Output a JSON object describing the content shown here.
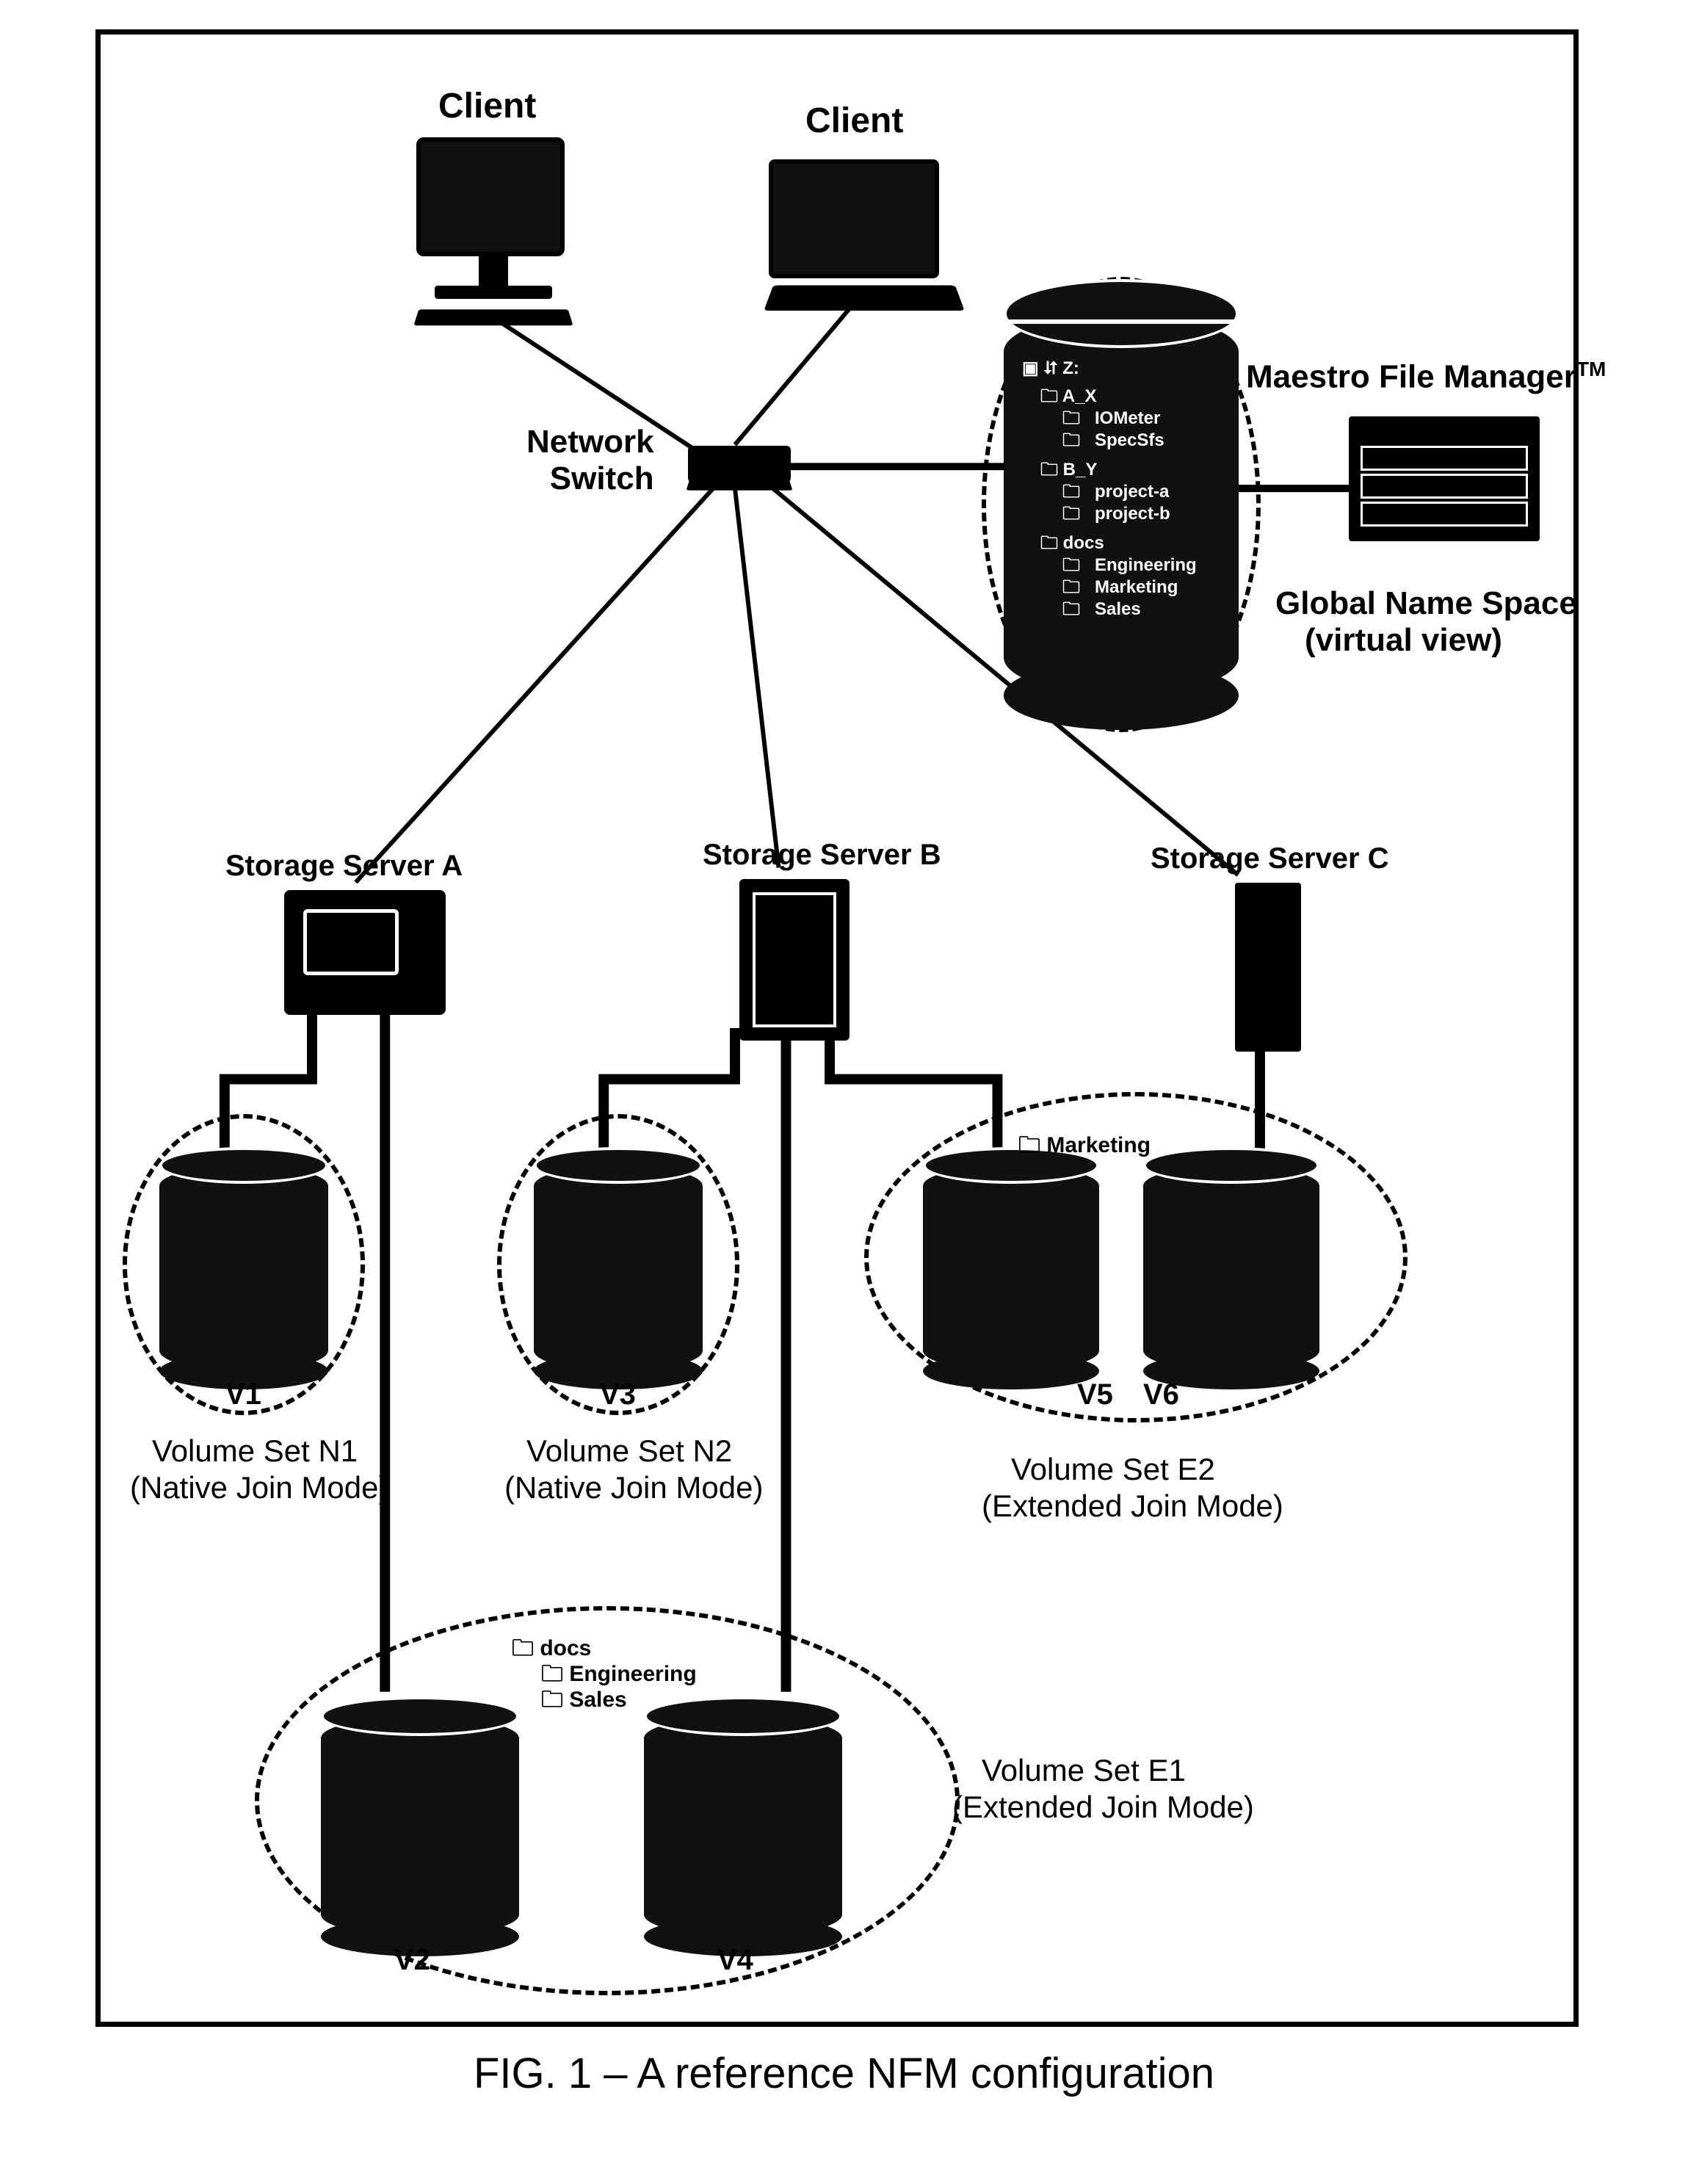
{
  "caption": "FIG. 1 – A reference NFM configuration",
  "labels": {
    "client1": "Client",
    "client2": "Client",
    "network_switch": "Network\nSwitch",
    "mfm": "Maestro File Manager",
    "mfm_tm": "TM",
    "gns_line1": "Global Name Space",
    "gns_line2": "(virtual view)",
    "serverA": "Storage Server A",
    "serverB": "Storage Server B",
    "serverC": "Storage Server C",
    "v1": "V1",
    "v2": "V2",
    "v3": "V3",
    "v4": "V4",
    "v5": "V5",
    "v6": "V6",
    "vs_n1_line1": "Volume Set N1",
    "vs_n1_line2": "(Native Join Mode)",
    "vs_n2_line1": "Volume Set N2",
    "vs_n2_line2": "(Native Join Mode)",
    "vs_e1_line1": "Volume Set E1",
    "vs_e1_line2": "(Extended Join Mode)",
    "vs_e2_line1": "Volume Set E2",
    "vs_e2_line2": "(Extended Join Mode)"
  },
  "gns_tree": {
    "root": "Z:",
    "items": [
      "A_X",
      "  IOMeter",
      "  SpecSfs",
      "B_Y",
      "  project-a",
      "  project-b",
      "docs",
      "  Engineering",
      "  Marketing",
      "  Sales"
    ]
  },
  "e1_folders": [
    "docs",
    "Engineering",
    "Sales"
  ],
  "e2_folders": [
    "Marketing"
  ]
}
